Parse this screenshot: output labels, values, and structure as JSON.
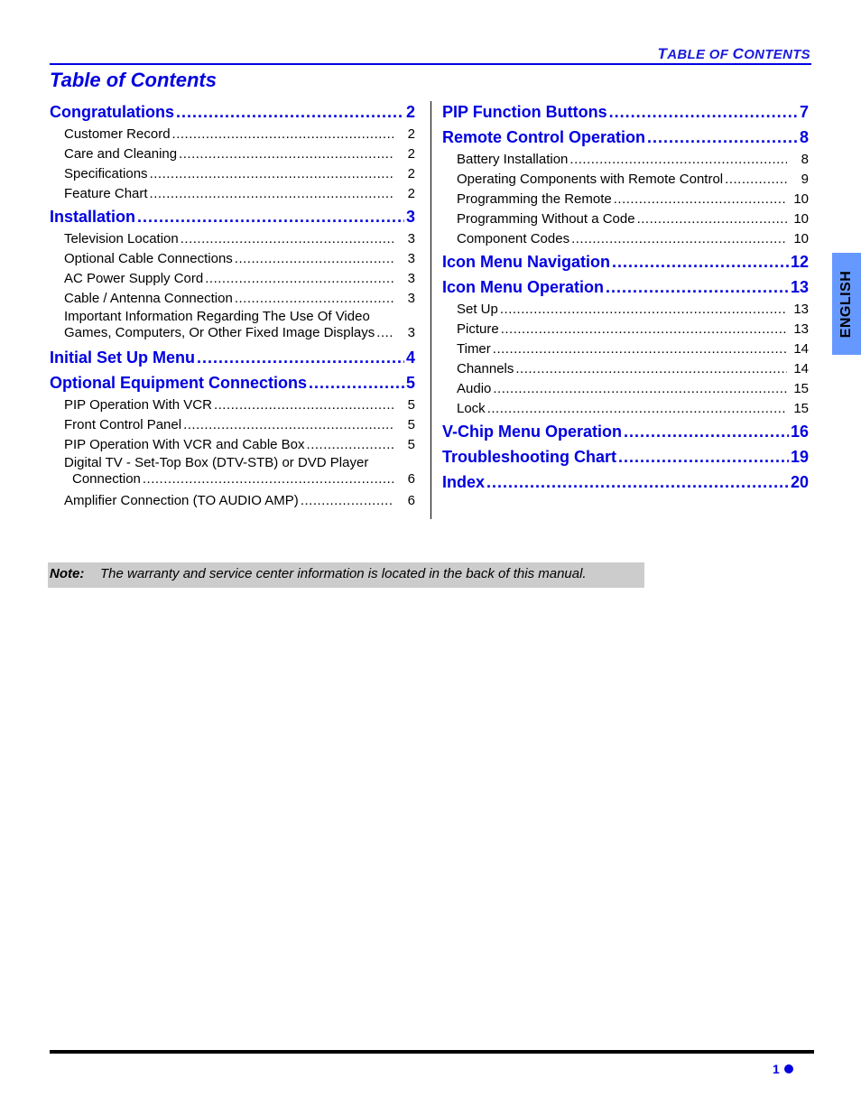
{
  "header": {
    "running_head_parts": [
      {
        "text": "T",
        "big": true
      },
      {
        "text": "ABLE OF ",
        "big": false
      },
      {
        "text": "C",
        "big": true
      },
      {
        "text": "ONTENTS",
        "big": false
      }
    ],
    "title": "Table of Contents"
  },
  "toc": {
    "left": [
      {
        "label": "Congratulations",
        "page": "2",
        "items": [
          {
            "label": "Customer Record",
            "page": "2"
          },
          {
            "label": "Care and Cleaning",
            "page": "2"
          },
          {
            "label": "Specifications",
            "page": "2"
          },
          {
            "label": "Feature Chart",
            "page": "2"
          }
        ]
      },
      {
        "label": "Installation",
        "page": "3",
        "items": [
          {
            "label": "Television Location",
            "page": "3"
          },
          {
            "label": "Optional Cable Connections",
            "page": "3"
          },
          {
            "label": "AC Power Supply Cord",
            "page": "3"
          },
          {
            "label": "Cable / Antenna Connection",
            "page": "3"
          },
          {
            "label_line1": "Important Information Regarding The Use Of Video",
            "label": "Games, Computers, Or Other Fixed Image Displays",
            "page": "3"
          }
        ]
      },
      {
        "label": "Initial Set Up Menu",
        "page": "4",
        "items": []
      },
      {
        "label": "Optional Equipment Connections",
        "page": "5",
        "items": [
          {
            "label": "PIP Operation With VCR",
            "page": "5"
          },
          {
            "label": "Front Control Panel",
            "page": "5"
          },
          {
            "label": "PIP Operation With VCR and Cable Box",
            "page": "5"
          },
          {
            "label_line1": "Digital TV - Set-Top Box (DTV-STB) or DVD Player",
            "label": "Connection",
            "page": "6"
          },
          {
            "label": "Amplifier Connection (TO AUDIO AMP)",
            "page": "6"
          }
        ]
      }
    ],
    "right": [
      {
        "label": "PIP Function Buttons",
        "page": "7",
        "items": []
      },
      {
        "label": "Remote Control Operation",
        "page": "8",
        "items": [
          {
            "label": "Battery Installation",
            "page": "8"
          },
          {
            "label": "Operating Components with Remote Control",
            "page": "9"
          },
          {
            "label": "Programming the Remote",
            "page": "10"
          },
          {
            "label": "Programming Without a Code",
            "page": "10"
          },
          {
            "label": "Component Codes",
            "page": "10"
          }
        ]
      },
      {
        "label": "Icon Menu Navigation",
        "page": "12",
        "items": []
      },
      {
        "label": "Icon Menu Operation",
        "page": "13",
        "items": [
          {
            "label": "Set Up",
            "page": "13"
          },
          {
            "label": "Picture",
            "page": "13"
          },
          {
            "label": "Timer",
            "page": "14"
          },
          {
            "label": "Channels",
            "page": "14"
          },
          {
            "label": "Audio",
            "page": "15"
          },
          {
            "label": "Lock",
            "page": "15"
          }
        ]
      },
      {
        "label": "V-Chip Menu Operation",
        "page": "16",
        "items": []
      },
      {
        "label": "Troubleshooting Chart",
        "page": "19",
        "items": []
      },
      {
        "label": "Index",
        "page": "20",
        "items": []
      }
    ]
  },
  "side_tab": {
    "label": "ENGLISH"
  },
  "note": {
    "label": "Note:",
    "text": "The warranty and service center information is located in the back of  this manual."
  },
  "footer": {
    "page_number": "1"
  },
  "colors": {
    "heading_blue": "#0000e0",
    "tab_blue": "#6699ff",
    "note_gray": "#cccccc"
  }
}
